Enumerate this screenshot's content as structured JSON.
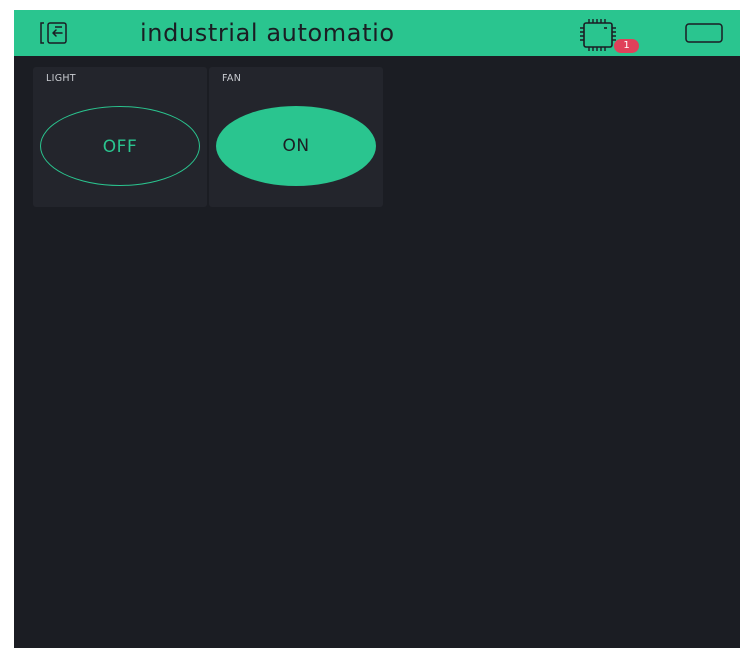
{
  "header": {
    "title": "industrial automatio",
    "exit_icon": "exit-icon",
    "device_icon": "device-chip-icon",
    "device_badge_count": "1",
    "dashboard_icon": "dashboard-icon"
  },
  "widgets": [
    {
      "label": "LIGHT",
      "button_text": "OFF",
      "state": "off"
    },
    {
      "label": "FAN",
      "button_text": "ON",
      "state": "on"
    }
  ],
  "colors": {
    "accent": "#2ac58f",
    "background": "#1b1d23",
    "widget_background": "#23252c",
    "badge": "#e0415a"
  }
}
